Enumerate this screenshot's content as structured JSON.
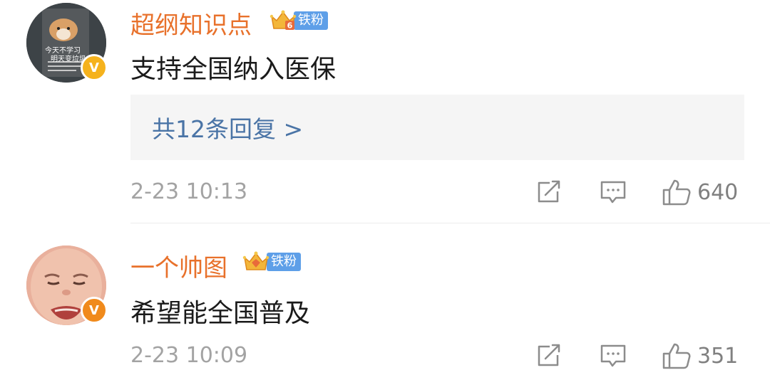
{
  "comments": [
    {
      "username": "超纲知识点",
      "fan_level": "6",
      "fan_label": "铁粉",
      "avatar_text_1": "今天不学习",
      "avatar_text_2": "明天变垃圾",
      "verified_badge": "V",
      "text": "支持全国纳入医保",
      "replies_label": "共12条回复 >",
      "timestamp": "2-23 10:13",
      "likes": "640"
    },
    {
      "username": "一个帅图",
      "fan_level": "",
      "fan_label": "铁粉",
      "verified_badge": "V",
      "text": "希望能全国普及",
      "timestamp": "2-23 10:09",
      "likes": "351"
    }
  ],
  "colors": {
    "username": "#e8712b",
    "fan_label_bg": "#5e9fe8",
    "replies_link": "#4a74a6",
    "timestamp": "#a3a3a3"
  },
  "icons": [
    "share-icon",
    "comment-icon",
    "like-icon",
    "crown-icon",
    "verified-icon"
  ]
}
